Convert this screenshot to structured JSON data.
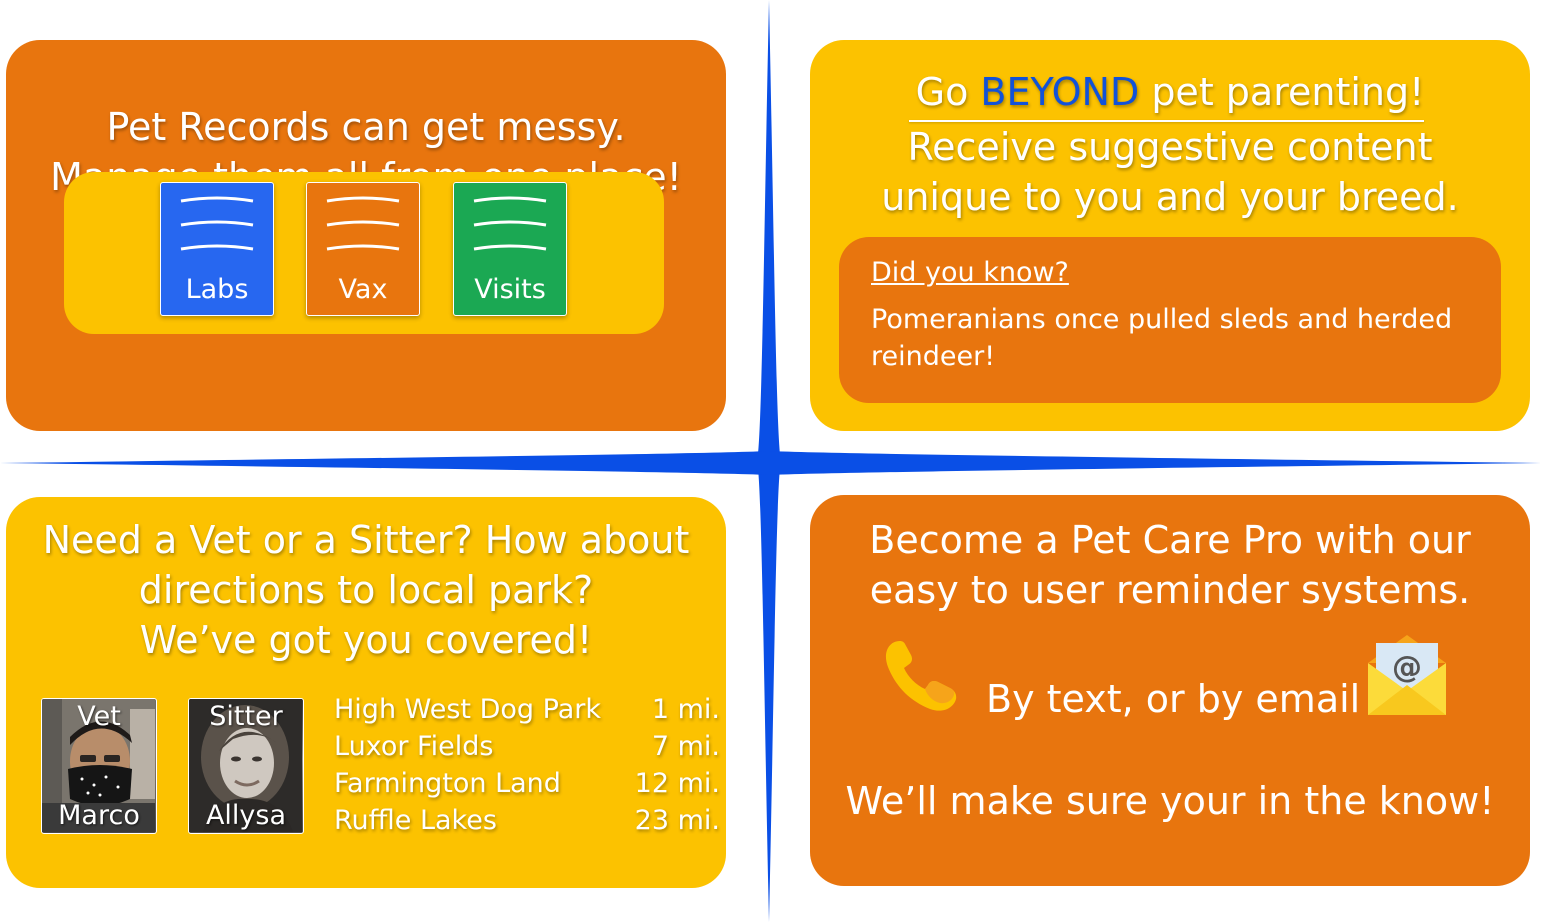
{
  "colors": {
    "orange": "#E8750E",
    "yellow": "#FCC200",
    "divider_blue": "#0A4FE6",
    "beyond_blue": "#1152D9",
    "labs_blue": "#2767F0",
    "visits_green": "#1BA853"
  },
  "records": {
    "heading_line1": "Pet Records can get messy.",
    "heading_line2": "Manage them all from one place!",
    "docs": [
      {
        "label": "Labs",
        "icon": "document-lines-icon"
      },
      {
        "label": "Vax",
        "icon": "document-lines-icon"
      },
      {
        "label": "Visits",
        "icon": "document-lines-icon"
      }
    ]
  },
  "content": {
    "line1_pre": "Go ",
    "line1_highlight": "BEYOND",
    "line1_post": " pet parenting!",
    "line2": "Receive suggestive content",
    "line3": "unique to you and your breed.",
    "fact_title": "Did you know?",
    "fact_text": "Pomeranians once pulled sleds and herded reindeer!"
  },
  "local": {
    "heading_line1": "Need a Vet or a Sitter? How about",
    "heading_line2": "directions to local park?",
    "heading_line3": "We’ve got you covered!",
    "contacts": [
      {
        "role": "Vet",
        "name": "Marco",
        "icon": "person-photo"
      },
      {
        "role": "Sitter",
        "name": "Allysa",
        "icon": "person-photo"
      }
    ],
    "parks": [
      {
        "name": "High West Dog Park",
        "distance": "1 mi."
      },
      {
        "name": "Luxor Fields",
        "distance": "7 mi."
      },
      {
        "name": "Farmington Land",
        "distance": "12 mi."
      },
      {
        "name": "Ruffle Lakes",
        "distance": "23 mi."
      }
    ]
  },
  "reminders": {
    "heading_line1": "Become a Pet Care Pro with our",
    "heading_line2": "easy to user reminder  systems.",
    "channels_text": "By text, or by email",
    "phone_icon": "phone-icon",
    "email_icon": "email-envelope-icon",
    "email_symbol": "@",
    "closing": "We’ll make sure your in the know!"
  }
}
